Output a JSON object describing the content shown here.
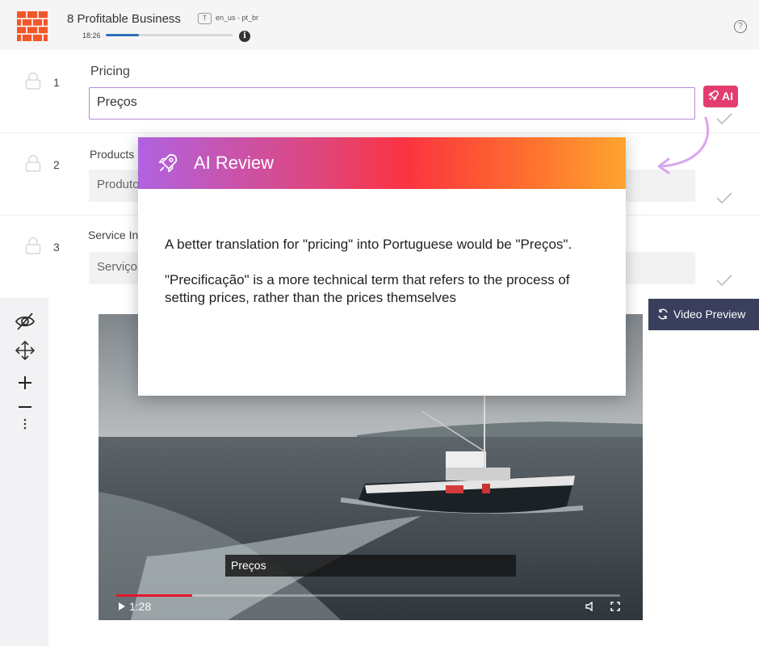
{
  "header": {
    "title": "8 Profitable Business",
    "lang_badge": "T",
    "lang_pair": "en_us - pt_br",
    "time": "18:26",
    "progress_fraction": 0.26,
    "info_glyph": "i",
    "help_glyph": "?"
  },
  "rows": [
    {
      "number": "1",
      "label": "Pricing",
      "value": "Preços"
    },
    {
      "number": "2",
      "label": "Products",
      "value": "Produtos"
    },
    {
      "number": "3",
      "label": "Service In",
      "value": "Serviços"
    }
  ],
  "ai_button": {
    "label": "AI",
    "color": "#e33d6f"
  },
  "modal": {
    "title": "AI Review",
    "paragraph_1": "A better translation for \"pricing\" into Portuguese would be \"Preços\".",
    "paragraph_2": "\"Precificação\" is a more technical term that refers to the process of setting prices, rather than the prices themselves"
  },
  "video_preview_button": {
    "label": "Video Preview"
  },
  "video": {
    "subtitle": "Preços",
    "time": "1:28",
    "played_fraction": 0.15
  },
  "toolbar_icons": [
    "eye-off-icon",
    "move-icon",
    "plus-icon",
    "minus-icon",
    "more-vertical-icon"
  ],
  "colors": {
    "accent_blue": "#2f6fb8",
    "logo_orange": "#f2572a",
    "dark_button": "#3a3f5e"
  }
}
